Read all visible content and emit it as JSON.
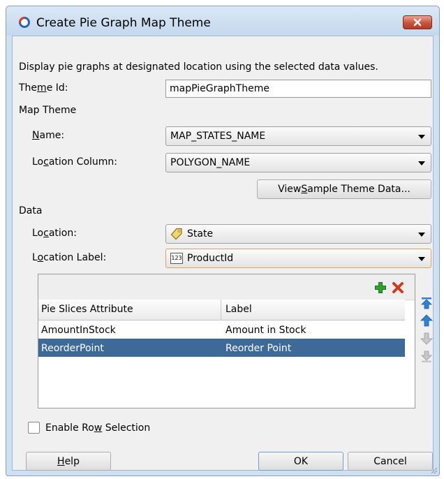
{
  "dialog": {
    "title": "Create Pie Graph Map Theme",
    "description": "Display pie graphs at designated location using the selected data values."
  },
  "theme_id": {
    "label_pre": "The",
    "label_u": "m",
    "label_post": "e Id:",
    "value": "mapPieGraphTheme"
  },
  "map_theme": {
    "section": "Map Theme",
    "name_label_u": "N",
    "name_label_post": "ame:",
    "name_value": "MAP_STATES_NAME",
    "location_column_label_pre": "Lo",
    "location_column_label_u": "c",
    "location_column_label_post": "ation Column:",
    "location_column_value": "POLYGON_NAME",
    "view_sample_pre": "View ",
    "view_sample_u": "S",
    "view_sample_post": "ample Theme Data..."
  },
  "data": {
    "section": "Data",
    "location_label_pre": "Lo",
    "location_label_u": "c",
    "location_label_post": "ation:",
    "location_value": "State",
    "location_icon": "tag-icon",
    "location_label_label_pre": "L",
    "location_label_label_u": "o",
    "location_label_label_post": "cation Label:",
    "location_label_value": "ProductId",
    "location_label_icon": "number-type-icon",
    "number_badge": "123"
  },
  "table": {
    "columns": [
      "Pie Slices Attribute",
      "Label"
    ],
    "rows": [
      {
        "attribute": "AmountInStock",
        "label": "Amount in Stock"
      },
      {
        "attribute": "ReorderPoint",
        "label": "Reorder Point"
      }
    ],
    "selected_row": 1,
    "toolbar_icons": [
      "add-icon",
      "delete-icon"
    ],
    "side_icons": [
      "move-top-icon",
      "move-up-icon",
      "move-down-icon",
      "move-bottom-icon"
    ]
  },
  "enable_row_selection": {
    "label_pre": "Enable Ro",
    "label_u": "w",
    "label_post": " Selection",
    "checked": false
  },
  "buttons": {
    "help_u": "H",
    "help_post": "elp",
    "ok": "OK",
    "cancel": "Cancel"
  },
  "colors": {
    "selection": "#3e6a9a",
    "add": "#2aa52a",
    "delete": "#d03b1f",
    "arrow_blue": "#2f80d8",
    "close": "#c9533a"
  }
}
